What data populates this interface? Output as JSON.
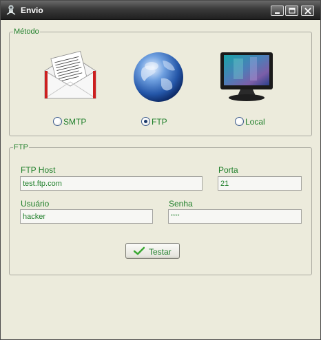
{
  "window": {
    "title": "Envio"
  },
  "method_group": {
    "label": "Método",
    "options": [
      {
        "icon": "envelope-letter-icon",
        "label": "SMTP",
        "selected": false
      },
      {
        "icon": "globe-icon",
        "label": "FTP",
        "selected": true
      },
      {
        "icon": "monitor-icon",
        "label": "Local",
        "selected": false
      }
    ]
  },
  "ftp_group": {
    "label": "FTP",
    "host": {
      "label": "FTP Host",
      "value": "test.ftp.com"
    },
    "port": {
      "label": "Porta",
      "value": "21"
    },
    "user": {
      "label": "Usuário",
      "value": "hacker"
    },
    "password": {
      "label": "Senha",
      "value": "****"
    },
    "test_button": {
      "label": "Testar",
      "icon": "green-checkmark-icon"
    }
  }
}
